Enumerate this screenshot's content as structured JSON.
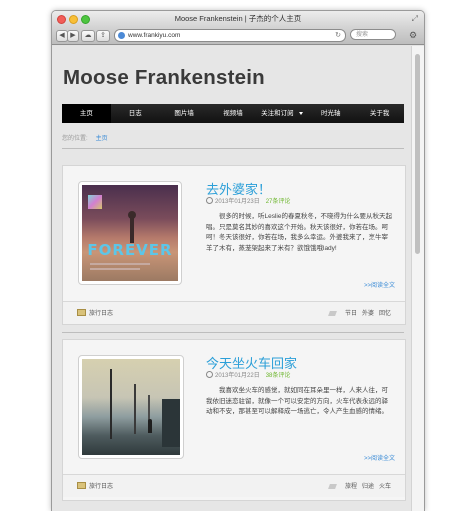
{
  "window": {
    "title": "Moose Frankenstein | 子杰的个人主页",
    "url": "www.frankiyu.com",
    "search_placeholder": "搜索"
  },
  "site": {
    "title": "Moose Frankenstein"
  },
  "nav": {
    "items": [
      {
        "label": "主页",
        "active": true
      },
      {
        "label": "日志",
        "active": false
      },
      {
        "label": "图片墙",
        "active": false
      },
      {
        "label": "视频墙",
        "active": false
      },
      {
        "label": "关注和订阅",
        "active": false
      },
      {
        "label": "时光轴",
        "active": false
      },
      {
        "label": "关于我",
        "active": false
      }
    ]
  },
  "breadcrumb": {
    "prefix": "您的位置:",
    "current": "主页"
  },
  "posts": [
    {
      "title": "去外婆家！",
      "date": "2013年01月23日",
      "comments": "27条评论",
      "excerpt": "很多的时候，听Leslie的春夏秋冬，不晓得为什么要从秋天起唱。只是莫名其妙的喜欢这个开始。秋天该很好，你若在场。呵呵！冬天该很好，你若在场，我多么幸运。外婆我来了，烹牛宰羊了木有，蒸茏架起来了米有？欲饿饿哦lady!",
      "thumb_text": "FOREVER",
      "more": ">>阅读全文",
      "category": "旅行日志",
      "tags": [
        "节日",
        "外婆",
        "回忆"
      ]
    },
    {
      "title": "今天坐火车回家",
      "date": "2013年01月22日",
      "comments": "38条评论",
      "excerpt": "我喜欢坐火车的感觉，就如同在耳朵里一样，人来人往，可我依旧迷恋驻留，就像一个可以安定的方向，火车代表永远的驿动和不安，那甚至可以解释成一场逃亡，令人产生血感的情绪。",
      "more": ">>阅读全文",
      "category": "旅行日志",
      "tags": [
        "旅程",
        "归途",
        "火车"
      ]
    }
  ],
  "colors": {
    "accent": "#2b9fd8",
    "nav_bg": "#1a1a1a",
    "comment_count": "#6bb52a"
  }
}
